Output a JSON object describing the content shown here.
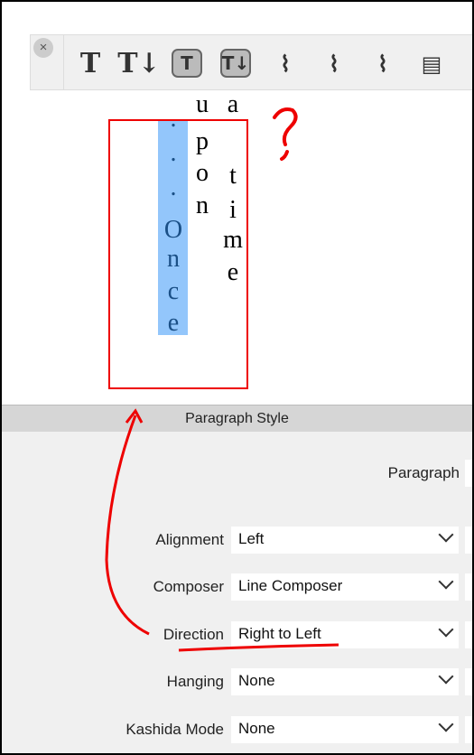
{
  "toolbar": {
    "close": "×",
    "tools": [
      {
        "icon": "text-horizontal-icon",
        "glyph": "T"
      },
      {
        "icon": "text-vertical-icon",
        "glyph": "T↓"
      },
      {
        "icon": "frame-text-horizontal-icon",
        "glyph": "T"
      },
      {
        "icon": "frame-text-vertical-icon",
        "glyph": "T↓"
      },
      {
        "icon": "text-on-path-icon",
        "glyph": "⌇"
      },
      {
        "icon": "text-on-path-vertical-icon",
        "glyph": "⌇"
      },
      {
        "icon": "text-on-path-frame-icon",
        "glyph": "⌇"
      },
      {
        "icon": "linked-document-icon",
        "glyph": "▤"
      }
    ]
  },
  "canvas": {
    "col1": [
      ".",
      ".",
      ".",
      "O",
      "n",
      "c",
      "e"
    ],
    "col2": [
      "u",
      "p",
      "o",
      "n"
    ],
    "col3": [
      "a",
      "t",
      "i",
      "m",
      "e"
    ],
    "selection_color": "#93c6fb",
    "annotation": "?"
  },
  "panel": {
    "title": "Paragraph Style",
    "paragraph_label": "Paragraph",
    "rows": [
      {
        "label": "Alignment",
        "value": "Left"
      },
      {
        "label": "Composer",
        "value": "Line Composer"
      },
      {
        "label": "Direction",
        "value": "Right to Left"
      },
      {
        "label": "Hanging",
        "value": "None"
      },
      {
        "label": "Kashida Mode",
        "value": "None"
      }
    ]
  }
}
